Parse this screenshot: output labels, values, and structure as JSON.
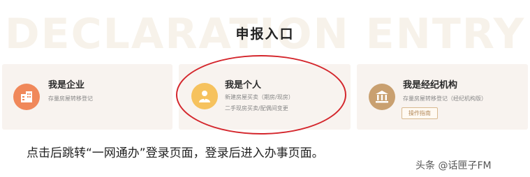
{
  "header": {
    "background_word": "DECLARATION ENTRY",
    "title": "申报入口"
  },
  "cards": [
    {
      "title": "我是企业",
      "lines": [
        "存量房屋转移登记"
      ],
      "icon": "building-icon",
      "color": "#f0885a"
    },
    {
      "title": "我是个人",
      "lines": [
        "新建房屋买卖（期房/现房）",
        "二手现房买卖/配偶间变更"
      ],
      "icon": "person-icon",
      "color": "#f6c25e"
    },
    {
      "title": "我是经纪机构",
      "lines": [
        "存量房屋转移登记（经纪机构版）"
      ],
      "button": "操作指南",
      "icon": "bank-icon",
      "color": "#c9a070"
    }
  ],
  "highlight_color": "#d4262c",
  "caption": "点击后跳转“一网通办”登录页面，登录后进入办事页面。",
  "watermark": "头条 @话匣子FM"
}
